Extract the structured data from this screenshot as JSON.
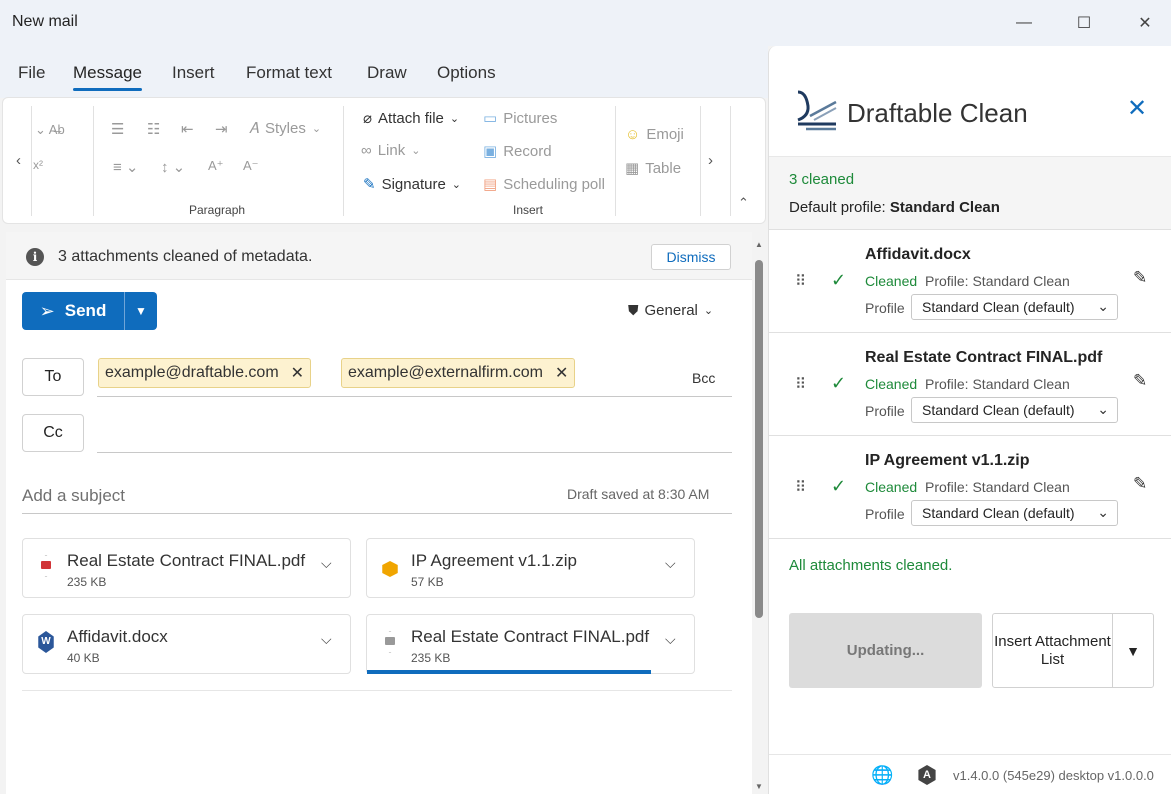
{
  "window": {
    "title": "New mail",
    "minimize_icon": "—",
    "maximize_icon": "☐",
    "close_icon": "✕"
  },
  "menu": {
    "tabs": [
      {
        "label": "File"
      },
      {
        "label": "Message",
        "active": true
      },
      {
        "label": "Insert"
      },
      {
        "label": "Format text"
      },
      {
        "label": "Draw"
      },
      {
        "label": "Options"
      }
    ]
  },
  "ribbon": {
    "styles_label": "Styles",
    "paragraph_group": "Paragraph",
    "insert_group": "Insert",
    "attach_file": "Attach file",
    "link": "Link",
    "signature": "Signature",
    "pictures": "Pictures",
    "record": "Record",
    "scheduling_poll": "Scheduling poll",
    "emoji": "Emoji",
    "table": "Table"
  },
  "infobar": {
    "message": "3 attachments cleaned of metadata.",
    "dismiss": "Dismiss"
  },
  "compose": {
    "send": "Send",
    "sensitivity": "General",
    "to_label": "To",
    "cc_label": "Cc",
    "bcc_label": "Bcc",
    "recipients": [
      "example@draftable.com",
      "example@externalfirm.com"
    ],
    "subject_placeholder": "Add a subject",
    "draft_status": "Draft saved at 8:30 AM",
    "attachments": [
      {
        "name": "Real Estate Contract FINAL.pdf",
        "size": "235 KB",
        "icon": "pdf-icon"
      },
      {
        "name": "IP Agreement v1.1.zip",
        "size": "57 KB",
        "icon": "zip-icon"
      },
      {
        "name": "Affidavit.docx",
        "size": "40 KB",
        "icon": "word-icon"
      },
      {
        "name": "Real Estate Contract FINAL.pdf",
        "size": "235 KB",
        "icon": "pdf-icon",
        "upload_progress": 0.87
      }
    ]
  },
  "pane": {
    "brand": "Draftable Clean",
    "cleaned_count": "3 cleaned",
    "default_profile_label": "Default profile:",
    "default_profile": "Standard Clean",
    "items": [
      {
        "name": "Affidavit.docx",
        "status": "Cleaned",
        "profile_info": "Profile: Standard Clean",
        "profile_label": "Profile",
        "profile_value": "Standard Clean (default)"
      },
      {
        "name": "Real Estate Contract FINAL.pdf",
        "status": "Cleaned",
        "profile_info": "Profile: Standard Clean",
        "profile_label": "Profile",
        "profile_value": "Standard Clean (default)"
      },
      {
        "name": "IP Agreement v1.1.zip",
        "status": "Cleaned",
        "profile_info": "Profile: Standard Clean",
        "profile_label": "Profile",
        "profile_value": "Standard Clean (default)"
      }
    ],
    "all_cleaned": "All attachments cleaned.",
    "updating": "Updating...",
    "insert_list": "Insert Attachment List",
    "version": "v1.4.0.0 (545e29) desktop v1.0.0.0"
  },
  "colors": {
    "accent": "#0f6cbd",
    "success": "#1e8a3a",
    "chip_bg": "#fdf2d0"
  }
}
